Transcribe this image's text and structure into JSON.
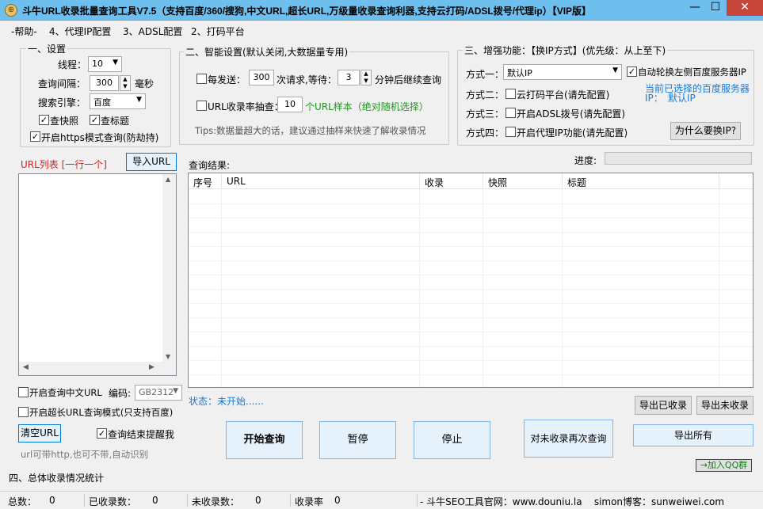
{
  "window": {
    "title": "斗牛URL收录批量查询工具V7.5（支持百度/360/搜狗,中文URL,超长URL,万级量收录查询利器,支持云打码/ADSL拨号/代理ip）【VIP版】",
    "minimize_label": "—",
    "maximize_label": "☐",
    "close_label": "✕"
  },
  "menu": [
    "-帮助-",
    "4、代理IP配置",
    "3、ADSL配置",
    "2、打码平台"
  ],
  "settings": {
    "group_title": "一、设置",
    "threads_label": "线程：",
    "threads_value": "10",
    "interval_label": "查询间隔：",
    "interval_value": "300",
    "interval_unit": "毫秒",
    "engine_label": "搜索引擎：",
    "engine_value": "百度",
    "check_snapshot": "查快照",
    "check_title": "查标题",
    "https_mode": "开启https模式查询(防劫持)"
  },
  "smart": {
    "group_title": "二、智能设置(默认关闭,大数据量专用)",
    "every_send_label": "每发送：",
    "every_send_value": "300",
    "requests_wait_label": "次请求,等待：",
    "wait_value": "3",
    "wait_suffix": "分钟后继续查询",
    "sample_label": "URL收录率抽查：",
    "sample_value": "10",
    "sample_suffix": "个URL样本（绝对随机选择）",
    "tips": "Tips:数据量超大的话，建议通过抽样来快速了解收录情况"
  },
  "enhance": {
    "group_title": "三、增强功能：【换IP方式】(优先级：从上至下)",
    "mode1_label": "方式一：",
    "mode1_value": "默认IP",
    "auto_rotate": "自动轮换左侧百度服务器IP",
    "mode2_label": "方式二：",
    "mode2_option": "云打码平台(请先配置)",
    "current_server_label": "当前已选择的百度服务器",
    "current_ip_label": "IP：",
    "current_ip_value": "默认IP",
    "mode3_label": "方式三：",
    "mode3_option": "开启ADSL拨号(请先配置)",
    "mode4_label": "方式四：",
    "mode4_option": "开启代理IP功能(请先配置)",
    "why_button": "为什么要换IP?"
  },
  "url_list": {
    "label": "URL列表 [一行一个]",
    "import_button": "导入URL",
    "chinese_url": "开启查询中文URL",
    "encoding_label": "编码:",
    "encoding_value": "GB2312",
    "long_url": "开启超长URL查询模式(只支持百度)",
    "clear_button": "清空URL",
    "remind_done": "查询结束提醒我",
    "hint": "url可带http,也可不带,自动识别"
  },
  "results": {
    "label": "查询结果:",
    "progress_label": "进度:",
    "progress_value": 0,
    "columns": [
      "序号",
      "URL",
      "收录",
      "快照",
      "标题"
    ],
    "status_text": "状态：未开始......",
    "export_indexed": "导出已收录",
    "export_unindexed": "导出未收录",
    "export_all": "导出所有"
  },
  "actions": {
    "start": "开始查询",
    "pause": "暂停",
    "stop": "停止",
    "requery": "对未收录再次查询",
    "join_qq": "→加入QQ群"
  },
  "summary": {
    "title": "四、总体收录情况统计"
  },
  "statusbar": {
    "total_label": "总数：",
    "total_value": "0",
    "indexed_label": "已收录数：",
    "indexed_value": "0",
    "unindexed_label": "未收录数：",
    "unindexed_value": "0",
    "rate_label": "收录率",
    "rate_value": "0",
    "site_text": "- 斗牛SEO工具官网：www.douniu.la    simon博客：sunweiwei.com"
  },
  "colors": {
    "titlebar": "#6fbfee",
    "close_button": "#c7463b",
    "red_label": "#d42020",
    "green_text": "#1a9a1a",
    "blue_text": "#1a7ad4"
  }
}
